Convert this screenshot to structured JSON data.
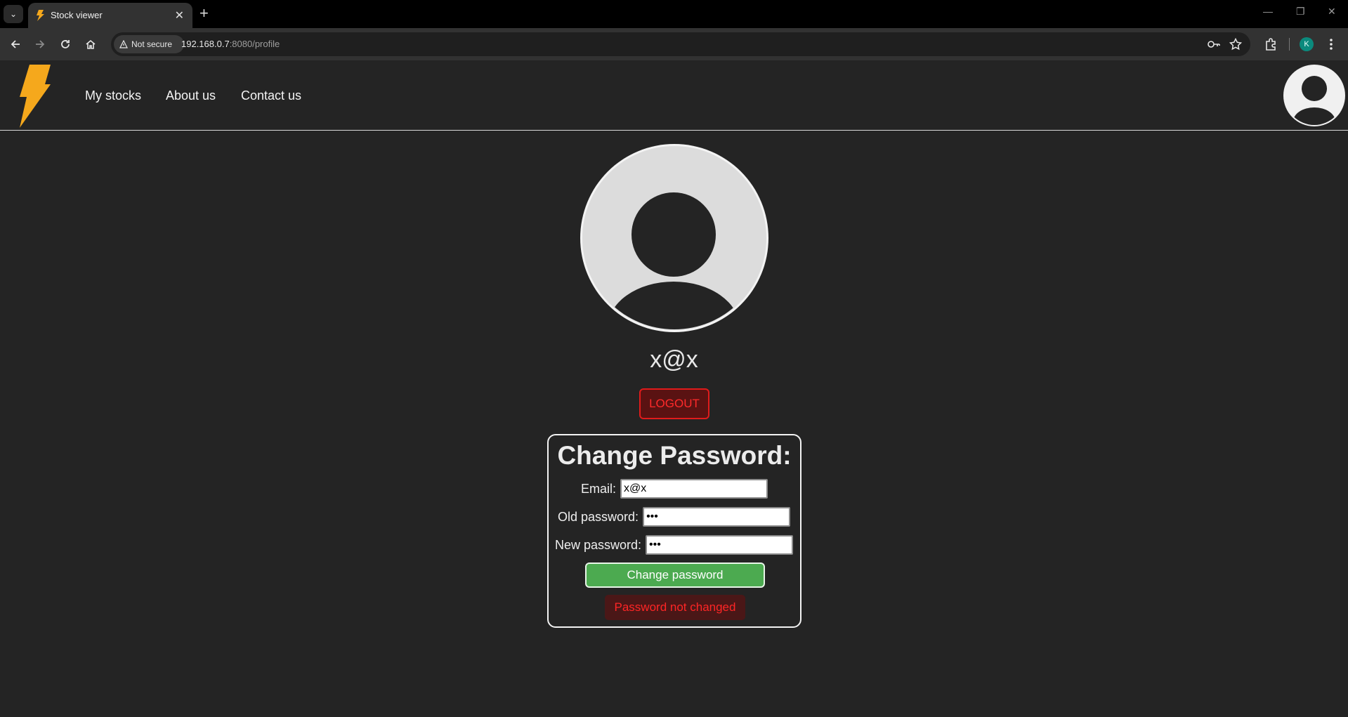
{
  "browser": {
    "tab_title": "Stock viewer",
    "security_label": "Not secure",
    "url_host": "192.168.0.7",
    "url_rest": ":8080/profile",
    "profile_initial": "K"
  },
  "header": {
    "nav": [
      "My stocks",
      "About us",
      "Contact us"
    ]
  },
  "profile": {
    "username": "x@x",
    "logout_label": "LOGOUT"
  },
  "change_password": {
    "title": "Change Password:",
    "email_label": "Email:",
    "email_value": "x@x",
    "old_label": "Old password:",
    "old_value": "abc",
    "new_label": "New password:",
    "new_value": "abc",
    "submit_label": "Change password",
    "status": "Password not changed"
  },
  "colors": {
    "background": "#242424",
    "logo": "#f5a81c",
    "success_button": "#4caa50",
    "error": "#ff2525"
  }
}
